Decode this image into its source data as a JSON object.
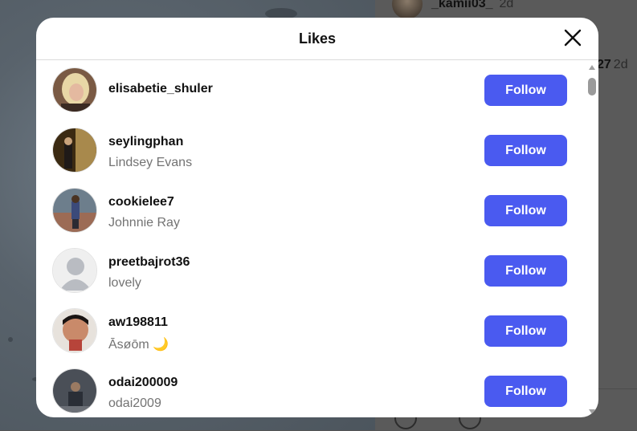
{
  "background": {
    "post_user": "_kamii03_",
    "post_time": "2d",
    "count_text": "27",
    "count_time": "2d"
  },
  "modal": {
    "title": "Likes",
    "follow_label": "Follow"
  },
  "likes": [
    {
      "username": "elisabetie_shuler",
      "fullname": "",
      "avatar": "avatar-photo"
    },
    {
      "username": "seylingphan",
      "fullname": "Lindsey Evans",
      "avatar": "avatar-photo"
    },
    {
      "username": "cookielee7",
      "fullname": "Johnnie Ray",
      "avatar": "avatar-photo"
    },
    {
      "username": "preetbajrot36",
      "fullname": "lovely",
      "avatar": "default-avatar-icon"
    },
    {
      "username": "aw198811",
      "fullname": "Āsøōm 🌙",
      "avatar": "avatar-photo"
    },
    {
      "username": "odai200009",
      "fullname": "odai2009",
      "avatar": "avatar-photo"
    }
  ],
  "colors": {
    "follow_button": "#4a5af0",
    "muted_text": "#737373",
    "overlay": "#555555"
  }
}
